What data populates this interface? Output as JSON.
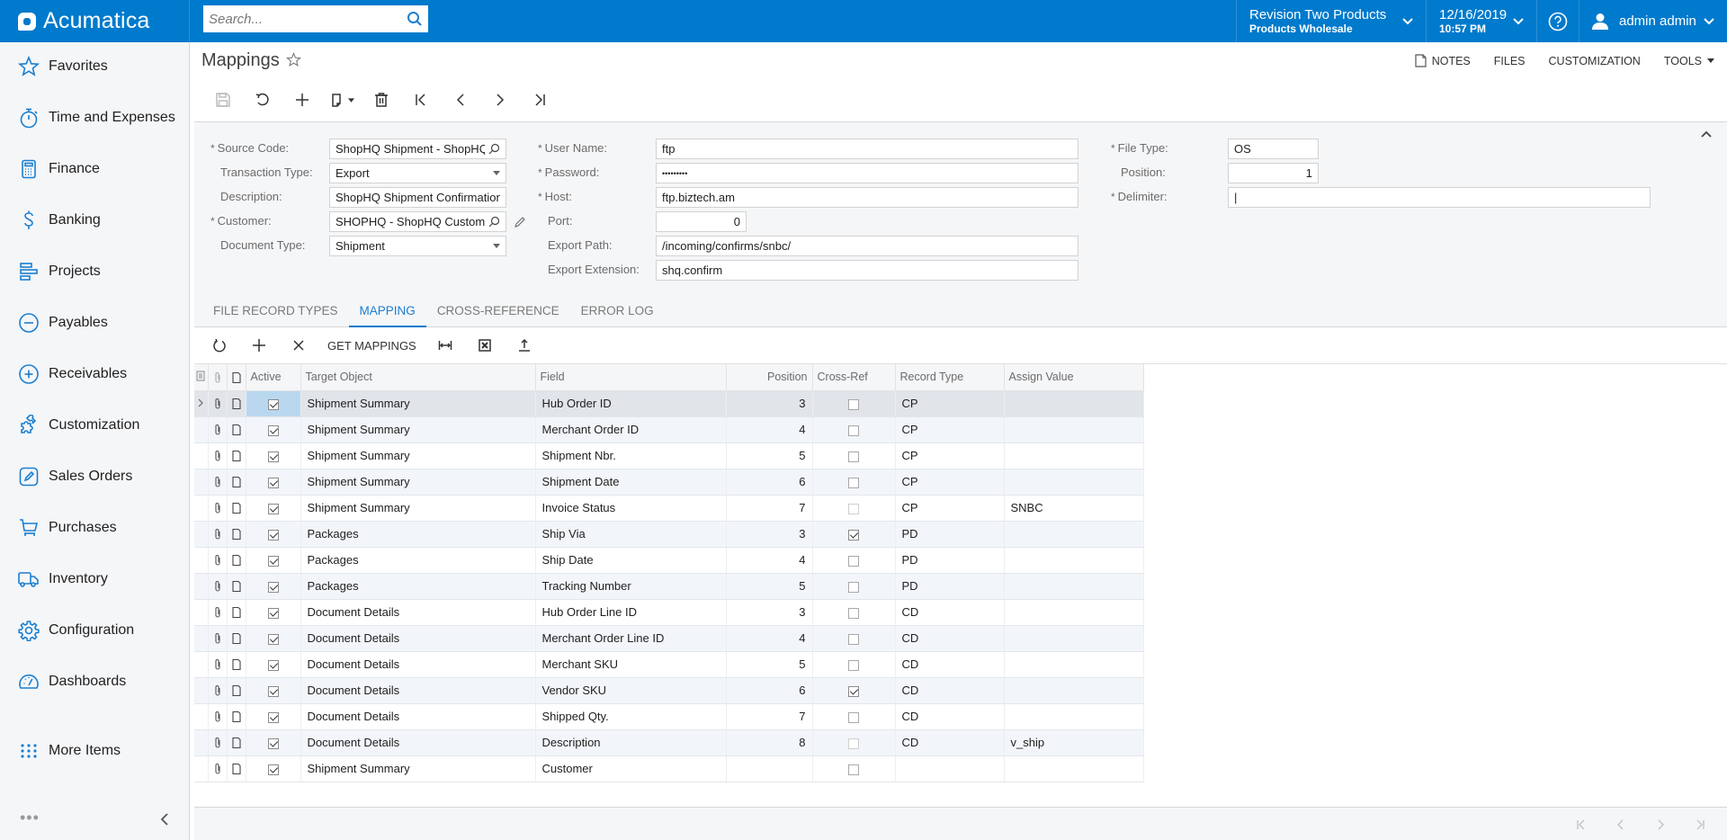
{
  "app": {
    "brand": "Acumatica",
    "search_placeholder": "Search...",
    "company": {
      "line1": "Revision Two Products",
      "line2": "Products Wholesale"
    },
    "datetime": {
      "date": "12/16/2019",
      "time": "10:57 PM"
    },
    "user": "admin admin",
    "accent_color": "#007ACC"
  },
  "sidebar": {
    "items": [
      {
        "label": "Favorites",
        "icon": "star-icon"
      },
      {
        "label": "Time and Expenses",
        "icon": "stopwatch-icon"
      },
      {
        "label": "Finance",
        "icon": "calculator-icon"
      },
      {
        "label": "Banking",
        "icon": "dollar-icon"
      },
      {
        "label": "Projects",
        "icon": "projects-icon"
      },
      {
        "label": "Payables",
        "icon": "minus-circle-icon"
      },
      {
        "label": "Receivables",
        "icon": "plus-circle-icon"
      },
      {
        "label": "Customization",
        "icon": "puzzle-icon"
      },
      {
        "label": "Sales Orders",
        "icon": "pencil-square-icon"
      },
      {
        "label": "Purchases",
        "icon": "cart-icon"
      },
      {
        "label": "Inventory",
        "icon": "truck-icon"
      },
      {
        "label": "Configuration",
        "icon": "gear-icon"
      },
      {
        "label": "Dashboards",
        "icon": "gauge-icon"
      },
      {
        "label": "More Items",
        "icon": "grid-dots-icon"
      }
    ],
    "bottom_dots": "•••"
  },
  "page": {
    "title": "Mappings",
    "top_links": {
      "notes": "NOTES",
      "files": "FILES",
      "customization": "CUSTOMIZATION",
      "tools": "TOOLS"
    }
  },
  "form": {
    "source_code": {
      "label": "Source Code:",
      "value": "ShopHQ Shipment - ShopHQ"
    },
    "transaction_type": {
      "label": "Transaction Type:",
      "value": "Export"
    },
    "description": {
      "label": "Description:",
      "value": "ShopHQ Shipment Confirmation"
    },
    "customer": {
      "label": "Customer:",
      "value": "SHOPHQ - ShopHQ Customer"
    },
    "document_type": {
      "label": "Document Type:",
      "value": "Shipment"
    },
    "user_name": {
      "label": "User Name:",
      "value": "ftp"
    },
    "password": {
      "label": "Password:",
      "value": "•••••••••"
    },
    "host": {
      "label": "Host:",
      "value": "ftp.biztech.am"
    },
    "port": {
      "label": "Port:",
      "value": "0"
    },
    "export_path": {
      "label": "Export Path:",
      "value": "/incoming/confirms/snbc/"
    },
    "export_extension": {
      "label": "Export Extension:",
      "value": "shq.confirm"
    },
    "file_type": {
      "label": "File Type:",
      "value": "OS"
    },
    "position": {
      "label": "Position:",
      "value": "1"
    },
    "delimiter": {
      "label": "Delimiter:",
      "value": "|"
    },
    "required_mark": "*"
  },
  "tabs": [
    {
      "label": "FILE RECORD TYPES",
      "active": false
    },
    {
      "label": "MAPPING",
      "active": true
    },
    {
      "label": "CROSS-REFERENCE",
      "active": false
    },
    {
      "label": "ERROR LOG",
      "active": false
    }
  ],
  "grid_toolbar": {
    "get_mappings": "GET MAPPINGS"
  },
  "grid": {
    "columns": [
      "Active",
      "Target Object",
      "Field",
      "Position",
      "Cross-Ref",
      "Record Type",
      "Assign Value"
    ],
    "rows": [
      {
        "active": true,
        "target": "Shipment Summary",
        "field": "Hub Order ID",
        "position": "3",
        "crossref": false,
        "record_type": "CP",
        "assign": ""
      },
      {
        "active": true,
        "target": "Shipment Summary",
        "field": "Merchant Order ID",
        "position": "4",
        "crossref": false,
        "record_type": "CP",
        "assign": ""
      },
      {
        "active": true,
        "target": "Shipment Summary",
        "field": "Shipment Nbr.",
        "position": "5",
        "crossref": false,
        "record_type": "CP",
        "assign": ""
      },
      {
        "active": true,
        "target": "Shipment Summary",
        "field": "Shipment Date",
        "position": "6",
        "crossref": false,
        "record_type": "CP",
        "assign": ""
      },
      {
        "active": true,
        "target": "Shipment Summary",
        "field": "Invoice Status",
        "position": "7",
        "crossref": false,
        "crossref_disabled": true,
        "record_type": "CP",
        "assign": "SNBC"
      },
      {
        "active": true,
        "target": "Packages",
        "field": "Ship Via",
        "position": "3",
        "crossref": true,
        "record_type": "PD",
        "assign": ""
      },
      {
        "active": true,
        "target": "Packages",
        "field": "Ship Date",
        "position": "4",
        "crossref": false,
        "record_type": "PD",
        "assign": ""
      },
      {
        "active": true,
        "target": "Packages",
        "field": "Tracking Number",
        "position": "5",
        "crossref": false,
        "record_type": "PD",
        "assign": ""
      },
      {
        "active": true,
        "target": "Document Details",
        "field": "Hub Order Line ID",
        "position": "3",
        "crossref": false,
        "record_type": "CD",
        "assign": ""
      },
      {
        "active": true,
        "target": "Document Details",
        "field": "Merchant Order Line ID",
        "position": "4",
        "crossref": false,
        "record_type": "CD",
        "assign": ""
      },
      {
        "active": true,
        "target": "Document Details",
        "field": "Merchant SKU",
        "position": "5",
        "crossref": false,
        "record_type": "CD",
        "assign": ""
      },
      {
        "active": true,
        "target": "Document Details",
        "field": "Vendor SKU",
        "position": "6",
        "crossref": true,
        "record_type": "CD",
        "assign": ""
      },
      {
        "active": true,
        "target": "Document Details",
        "field": "Shipped Qty.",
        "position": "7",
        "crossref": false,
        "record_type": "CD",
        "assign": ""
      },
      {
        "active": true,
        "target": "Document Details",
        "field": "Description",
        "position": "8",
        "crossref": false,
        "crossref_disabled": true,
        "record_type": "CD",
        "assign": "v_ship"
      },
      {
        "active": true,
        "target": "Shipment Summary",
        "field": "Customer",
        "position": "",
        "crossref": false,
        "record_type": "",
        "assign": ""
      }
    ]
  }
}
